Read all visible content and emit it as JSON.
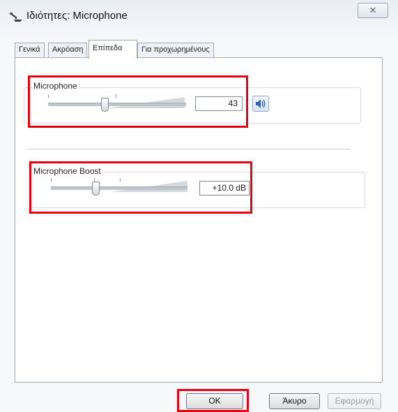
{
  "window": {
    "title": "Ιδιότητες: Microphone",
    "close_label": "✕"
  },
  "tabs": [
    {
      "label": "Γενικά"
    },
    {
      "label": "Ακρόαση"
    },
    {
      "label": "Επίπεδα"
    },
    {
      "label": "Για προχωρημένους"
    }
  ],
  "levels": {
    "microphone": {
      "label": "Microphone",
      "value": "43"
    },
    "boost": {
      "label": "Microphone Boost",
      "value": "+10.0 dB"
    }
  },
  "buttons": {
    "ok": "OK",
    "cancel": "Άκυρο",
    "apply": "Εφαρμογή"
  },
  "colors": {
    "highlight": "#e60012"
  }
}
